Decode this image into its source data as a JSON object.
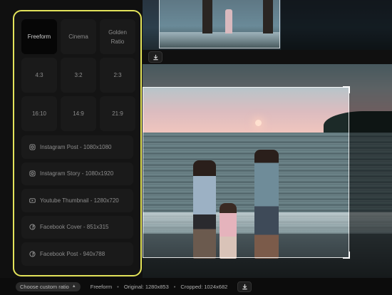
{
  "ratio_grid": [
    {
      "label": "Freeform",
      "active": true
    },
    {
      "label": "Cinema",
      "active": false
    },
    {
      "label": "Golden Ratio",
      "active": false
    },
    {
      "label": "4:3",
      "active": false
    },
    {
      "label": "3:2",
      "active": false
    },
    {
      "label": "2:3",
      "active": false
    },
    {
      "label": "16:10",
      "active": false
    },
    {
      "label": "14:9",
      "active": false
    },
    {
      "label": "21:9",
      "active": false
    }
  ],
  "presets": [
    {
      "label": "Instagram Post - 1080x1080",
      "icon": "instagram-icon"
    },
    {
      "label": "Instagram Story - 1080x1920",
      "icon": "instagram-icon"
    },
    {
      "label": "Youtube Thumbnail - 1280x720",
      "icon": "youtube-icon"
    },
    {
      "label": "Facebook Cover - 851x315",
      "icon": "facebook-icon"
    },
    {
      "label": "Facebook Post - 940x788",
      "icon": "facebook-icon"
    }
  ],
  "bottom_bar": {
    "custom_ratio_label": "Choose custom ratio",
    "current_ratio": "Freeform",
    "original": "Original: 1280x853",
    "cropped": "Cropped: 1024x682"
  },
  "colors": {
    "panel_highlight": "#e3e35a",
    "panel_bg": "#141414"
  }
}
